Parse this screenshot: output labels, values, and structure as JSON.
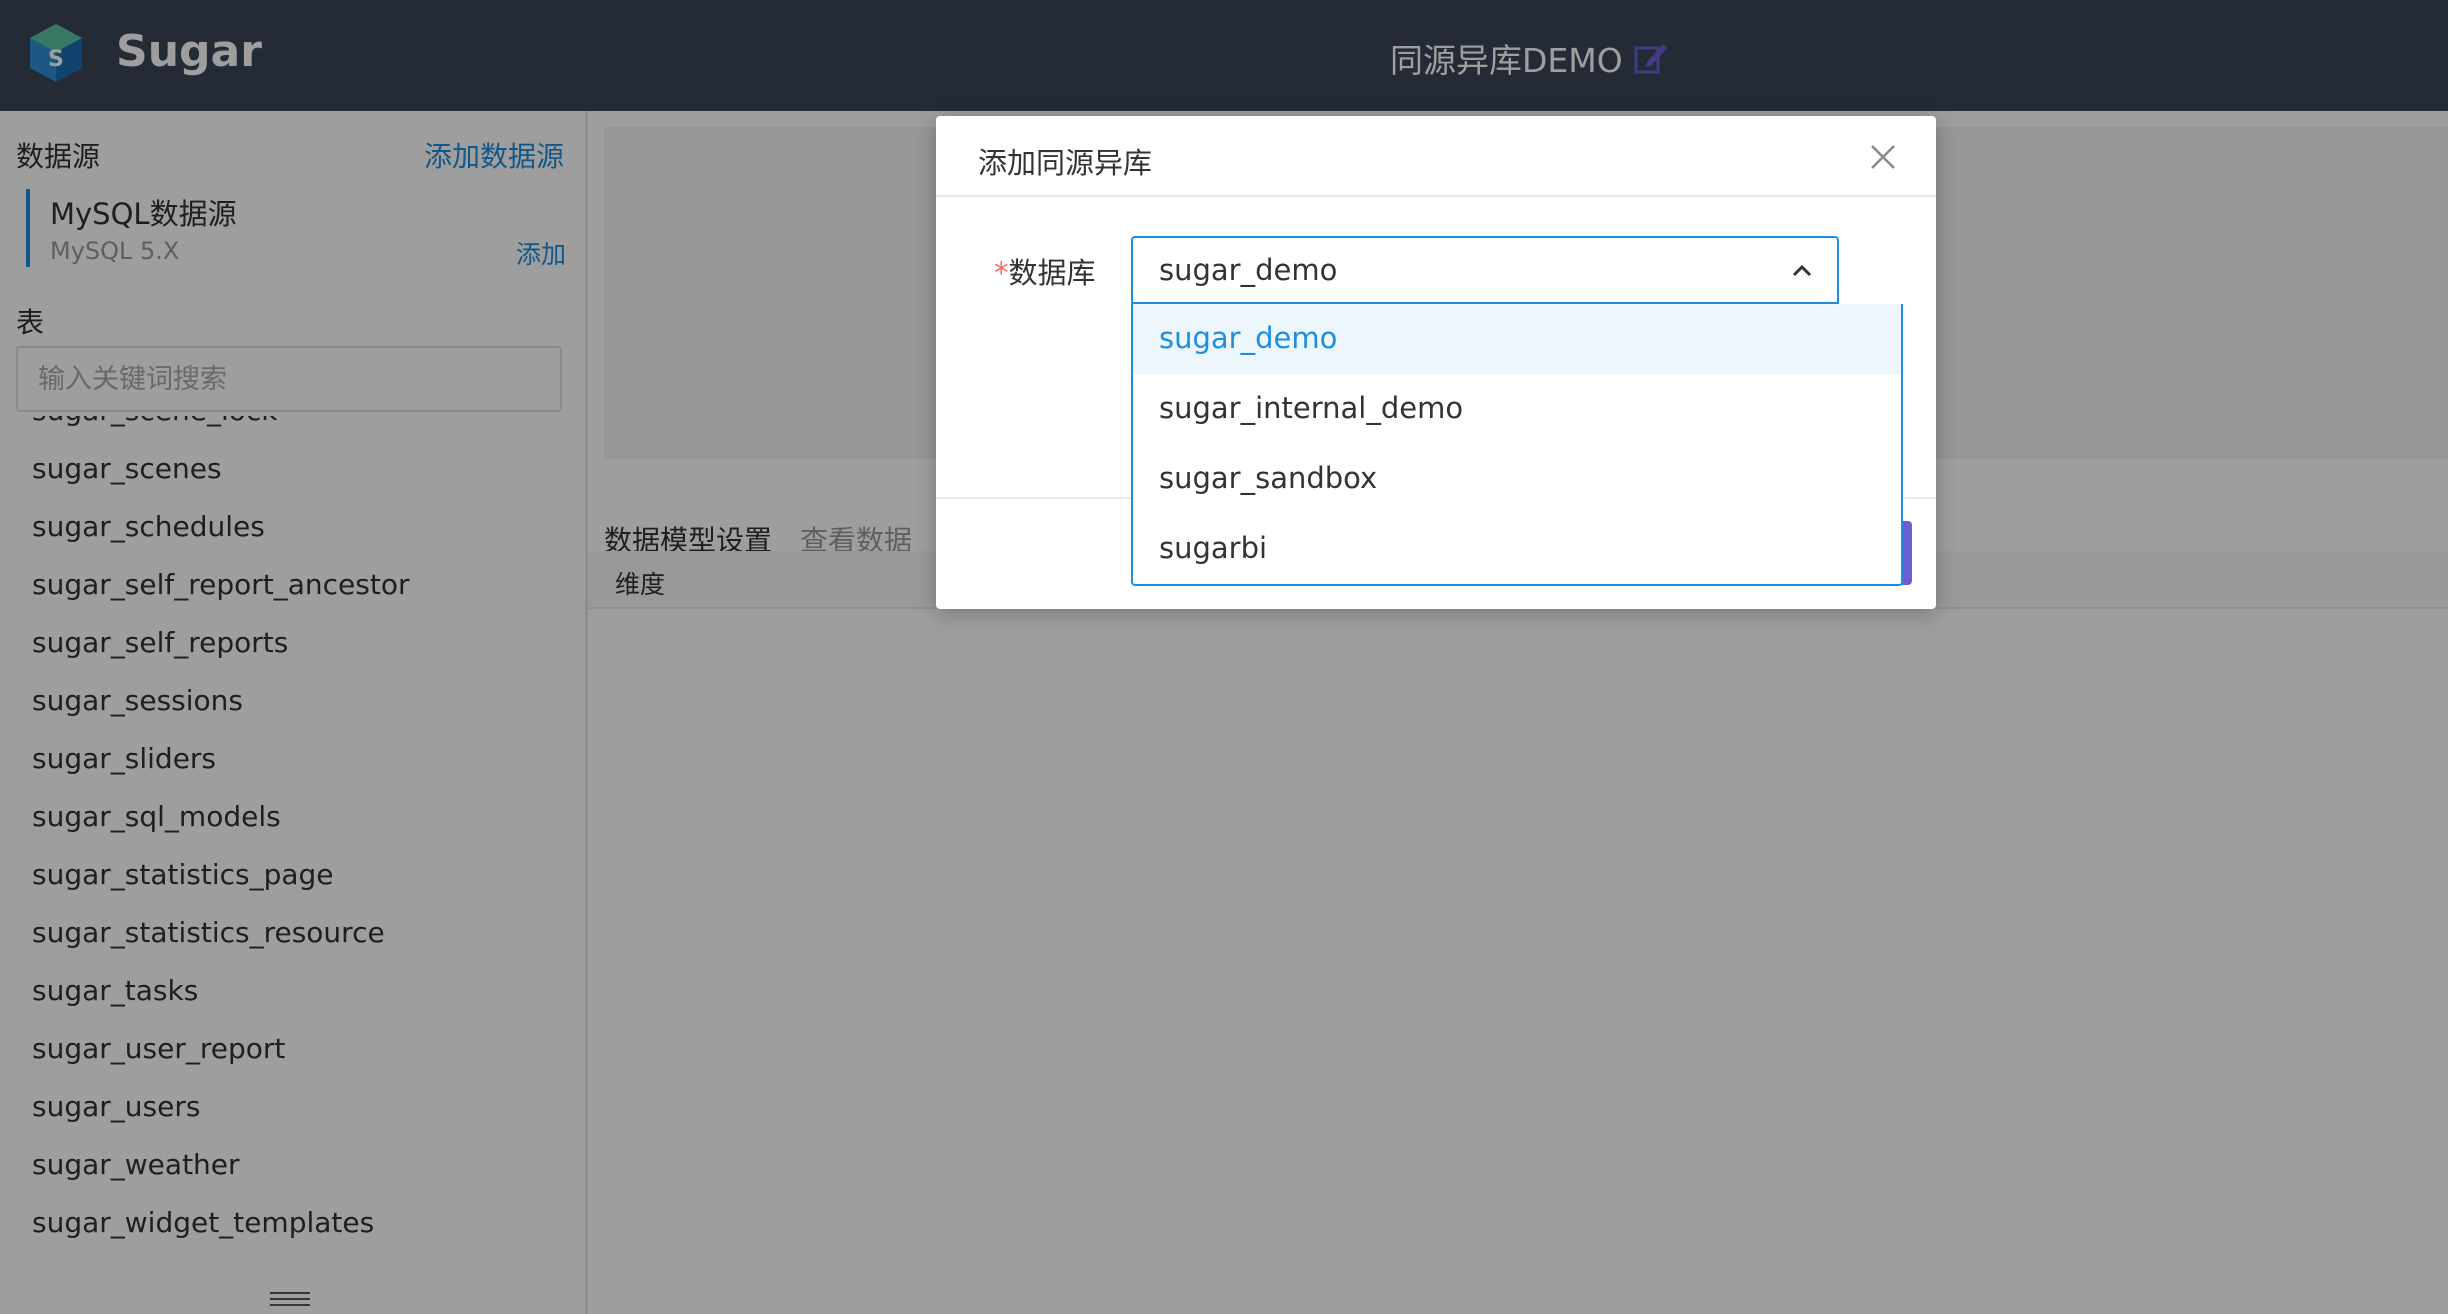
{
  "header": {
    "brand": "Sugar",
    "doc_title": "同源异库DEMO"
  },
  "sidebar": {
    "datasource_label": "数据源",
    "add_datasource": "添加数据源",
    "datasource": {
      "name": "MySQL数据源",
      "version": "MySQL 5.X",
      "add": "添加"
    },
    "table_label": "表",
    "search_placeholder": "输入关键词搜索",
    "tables": [
      "sugar_scene_lock",
      "sugar_scenes",
      "sugar_schedules",
      "sugar_self_report_ancestor",
      "sugar_self_reports",
      "sugar_sessions",
      "sugar_sliders",
      "sugar_sql_models",
      "sugar_statistics_page",
      "sugar_statistics_resource",
      "sugar_tasks",
      "sugar_user_report",
      "sugar_users",
      "sugar_weather",
      "sugar_widget_templates"
    ]
  },
  "main": {
    "tabs": [
      "数据模型设置",
      "查看数据"
    ],
    "dimension_header": "维度"
  },
  "dialog": {
    "title": "添加同源异库",
    "field_required_mark": "*",
    "field_label": "数据库",
    "selected_value": "sugar_demo",
    "options": [
      "sugar_demo",
      "sugar_internal_demo",
      "sugar_sandbox",
      "sugarbi"
    ]
  },
  "colors": {
    "header_bg": "#3b4458",
    "accent": "#1f8fdd",
    "primary_button": "#6a5fd3"
  }
}
